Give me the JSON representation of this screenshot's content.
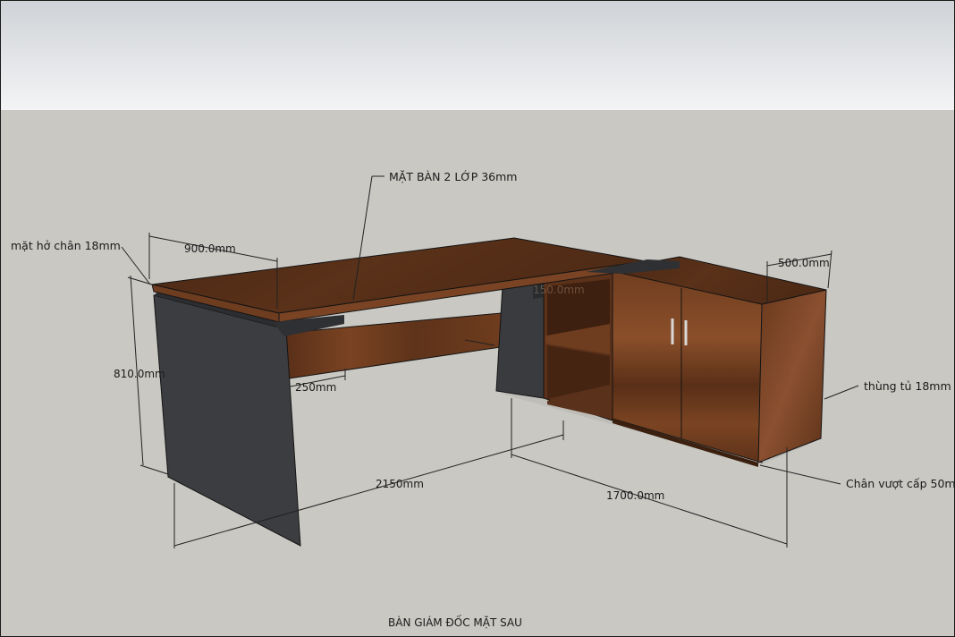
{
  "annotations": {
    "top_layer": "MẶT BÀN 2 LỚP 36mm",
    "leg_reveal": "mặt hở chân 18mm",
    "cabinet_box": "thùng tủ 18mm",
    "cabinet_plinth": "Chân vượt cấp 50mm"
  },
  "dimensions": {
    "desk_depth": "900.0mm",
    "desk_height": "810.0mm",
    "desk_length": "2150mm",
    "inset": "250mm",
    "cabinet_depth": "500.0mm",
    "cabinet_length": "1700.0mm",
    "hidden_label": "150.0mm"
  },
  "caption": "BÀN GIÁM ĐỐC MẶT SAU",
  "colors": {
    "wood_top": "#4f2b16",
    "wood_front": "#6a3a1d",
    "leg": "#3c3d40",
    "floor": "#c9c8c3"
  }
}
